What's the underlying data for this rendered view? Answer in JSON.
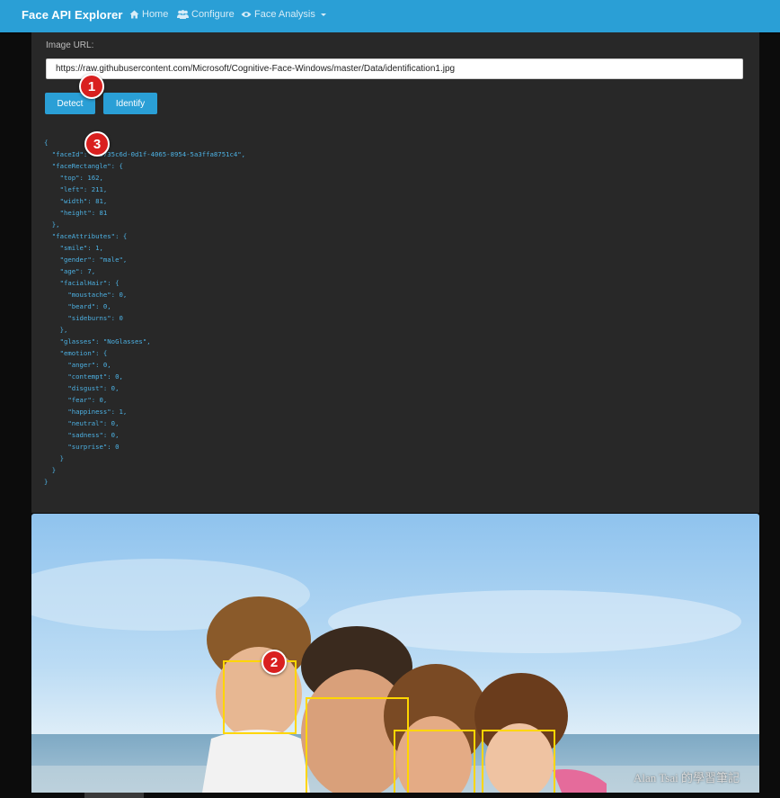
{
  "navbar": {
    "brand": "Face API Explorer",
    "items": [
      {
        "label": "Home",
        "icon": "home-icon"
      },
      {
        "label": "Configure",
        "icon": "users-icon"
      },
      {
        "label": "Face Analysis",
        "icon": "eye-icon"
      }
    ]
  },
  "form": {
    "url_label": "Image URL:",
    "url_value": "https://raw.githubusercontent.com/Microsoft/Cognitive-Face-Windows/master/Data/identification1.jpg",
    "detect_label": "Detect",
    "identify_label": "Identify"
  },
  "result_json": "{\n  \"faceId\": \"a6735c6d-0d1f-4065-8954-5a3ffa8751c4\",\n  \"faceRectangle\": {\n    \"top\": 162,\n    \"left\": 211,\n    \"width\": 81,\n    \"height\": 81\n  },\n  \"faceAttributes\": {\n    \"smile\": 1,\n    \"gender\": \"male\",\n    \"age\": 7,\n    \"facialHair\": {\n      \"moustache\": 0,\n      \"beard\": 0,\n      \"sideburns\": 0\n    },\n    \"glasses\": \"NoGlasses\",\n    \"emotion\": {\n      \"anger\": 0,\n      \"contempt\": 0,\n      \"disgust\": 0,\n      \"fear\": 0,\n      \"happiness\": 1,\n      \"neutral\": 0,\n      \"sadness\": 0,\n      \"surprise\": 0\n    }\n  }\n}",
  "annotations": [
    "1",
    "2",
    "3"
  ],
  "watermark": "Alan Tsai 的學習筆記",
  "colors": {
    "navbar": "#2a9fd6",
    "panel": "#282828",
    "json_text": "#4db1e3",
    "face_box": "#ffd600",
    "badge": "#d9201f"
  }
}
